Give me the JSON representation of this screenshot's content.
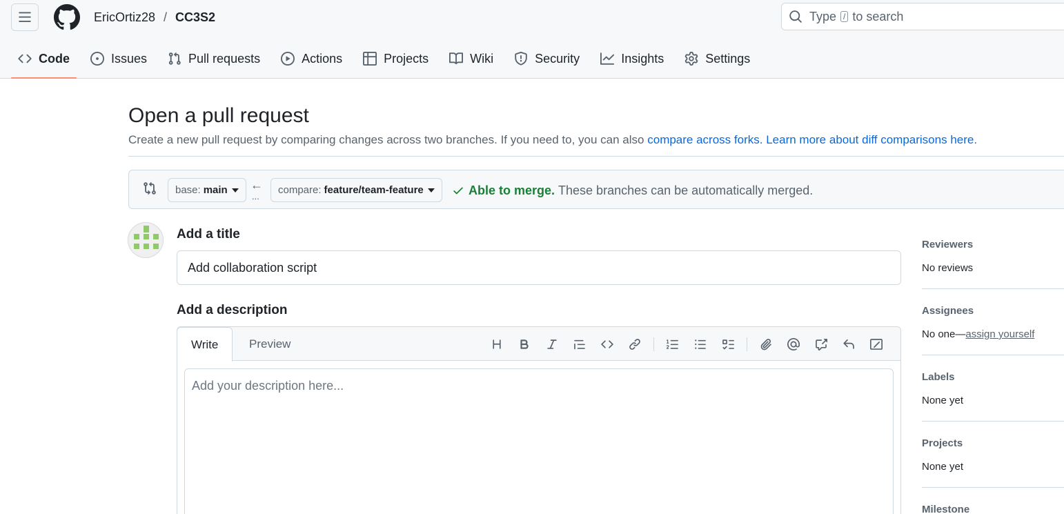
{
  "header": {
    "owner": "EricOrtiz28",
    "separator": "/",
    "repo": "CC3S2",
    "search_prefix": "Type",
    "search_key": "/",
    "search_suffix": "to search"
  },
  "nav": {
    "items": [
      {
        "label": "Code",
        "icon": "code-icon"
      },
      {
        "label": "Issues",
        "icon": "issue-opened-icon"
      },
      {
        "label": "Pull requests",
        "icon": "git-pull-request-icon"
      },
      {
        "label": "Actions",
        "icon": "play-icon"
      },
      {
        "label": "Projects",
        "icon": "table-icon"
      },
      {
        "label": "Wiki",
        "icon": "book-icon"
      },
      {
        "label": "Security",
        "icon": "shield-icon"
      },
      {
        "label": "Insights",
        "icon": "graph-icon"
      },
      {
        "label": "Settings",
        "icon": "gear-icon"
      }
    ],
    "active": "Code"
  },
  "page": {
    "title": "Open a pull request",
    "subtitle_text": "Create a new pull request by comparing changes across two branches. If you need to, you can also",
    "subtitle_link1": "compare across forks.",
    "subtitle_link2": "Learn more about diff comparisons here."
  },
  "compare": {
    "base_label": "base:",
    "base_value": "main",
    "arrow": "←",
    "dots": "...",
    "compare_label": "compare:",
    "compare_value": "feature/team-feature",
    "status_ok": "Able to merge.",
    "status_text": "These branches can be automatically merged."
  },
  "form": {
    "title_label": "Add a title",
    "title_value": "Add collaboration script",
    "desc_label": "Add a description",
    "tab_write": "Write",
    "tab_preview": "Preview",
    "desc_placeholder": "Add your description here..."
  },
  "sidebar": {
    "reviewers_label": "Reviewers",
    "reviewers_value": "No reviews",
    "assignees_label": "Assignees",
    "assignees_value": "No one—",
    "assignees_link": "assign yourself",
    "labels_label": "Labels",
    "labels_value": "None yet",
    "projects_label": "Projects",
    "projects_value": "None yet",
    "milestone_label": "Milestone"
  },
  "colors": {
    "accent": "#0969da",
    "success": "#1a7f37",
    "active_underline": "#fd8c73",
    "header_bg": "#f6f8fa"
  }
}
